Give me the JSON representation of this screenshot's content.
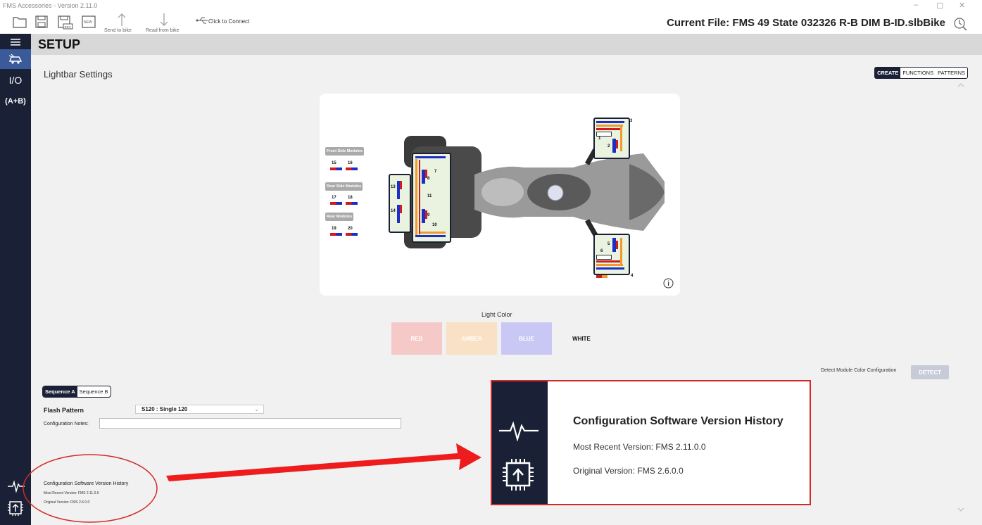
{
  "window": {
    "title": "FMS Accessories - Version 2.11.0",
    "minimize": "–",
    "restore": "▢",
    "close": "✕"
  },
  "toolbar": {
    "send_label": "Send to bike",
    "read_label": "Read from bike",
    "connect_label": "Click to Connect",
    "new_label": "NEW",
    "rev_label": "REV",
    "current_file": "Current File: FMS 49 State 032326 R-B DIM B-ID.slbBike"
  },
  "sidebar": {
    "items": [
      {
        "icon": "menu-icon"
      },
      {
        "icon": "vehicle-icon"
      },
      {
        "label": "I/O"
      },
      {
        "label": "(A+B)"
      }
    ]
  },
  "header": {
    "title": "SETUP"
  },
  "main": {
    "section_title": "Lightbar Settings",
    "mode_tabs": [
      "CREATE",
      "FUNCTIONS",
      "PATTERNS"
    ],
    "diagram": {
      "groups": [
        "Front Side Modules",
        "Rear Side Modules",
        "Rear Modules"
      ],
      "module_numbers": [
        "1",
        "2",
        "3",
        "4",
        "5",
        "6",
        "7",
        "8",
        "9",
        "10",
        "11",
        "12",
        "13",
        "14",
        "15",
        "16",
        "17",
        "18",
        "19",
        "20"
      ]
    },
    "light_color": {
      "title": "Light Color",
      "options": [
        "RED",
        "AMBER",
        "BLUE",
        "WHITE"
      ]
    },
    "detect": {
      "label": "Detect Module Color Configuration",
      "button": "DETECT"
    },
    "sequence_tabs": [
      "Sequence A",
      "Sequence B"
    ],
    "flash_pattern": {
      "label": "Flash Pattern",
      "value": "S120 : Single 120"
    },
    "config_notes": {
      "label": "Configuration Notes:",
      "value": ""
    },
    "history_small": {
      "title": "Configuration Software Version History",
      "recent": "Most Recent Version: FMS 2.11.0.0",
      "original": "Original Version: FMS 2.6.0.0"
    }
  },
  "callout": {
    "title": "Configuration Software Version History",
    "recent": "Most Recent Version: FMS 2.11.0.0",
    "original": "Original Version: FMS 2.6.0.0"
  },
  "colors": {
    "sidebar": "#1a2035",
    "red_btn": "#f6c9c9",
    "amber_btn": "#f8e1c4",
    "blue_btn": "#c9c8f4",
    "highlight": "#d12a2a",
    "arrow": "#ee1c1c"
  }
}
